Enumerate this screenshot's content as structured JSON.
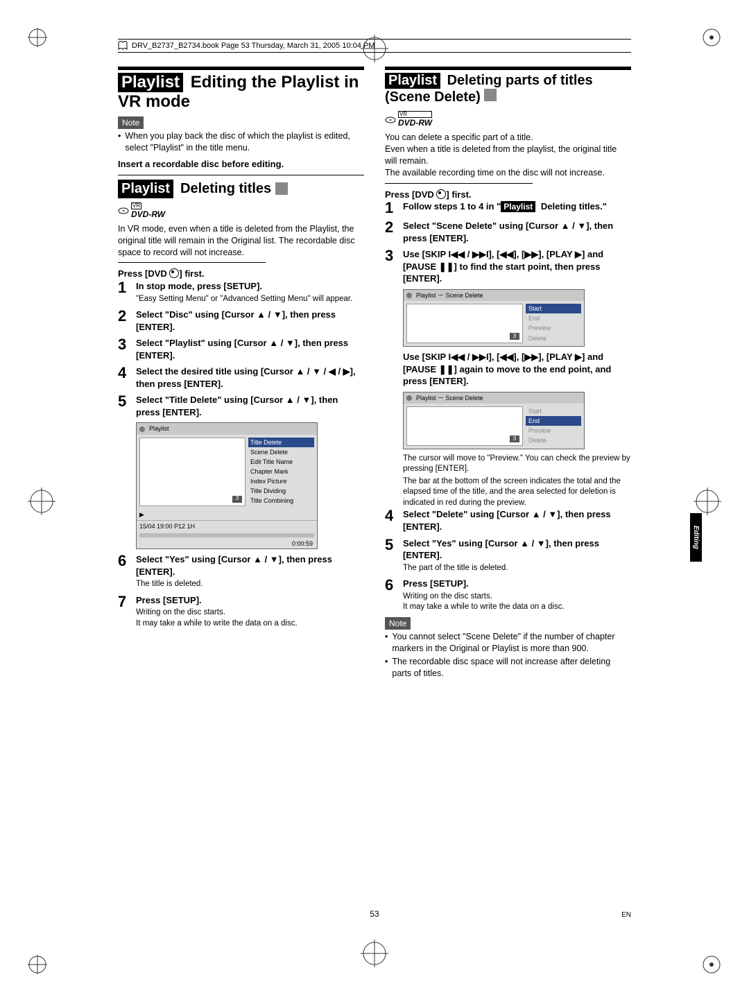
{
  "header": "DRV_B2737_B2734.book  Page 53  Thursday, March 31, 2005  10:04 PM",
  "left": {
    "title_pre": "Playlist",
    "title": " Editing the Playlist in VR mode",
    "note_label": "Note",
    "note_bullet": "When you play back the disc of which the playlist is edited, select \"Playlist\" in the title menu.",
    "insert": "Insert a recordable disc before editing.",
    "sub_pre": "Playlist",
    "sub": " Deleting titles ",
    "dvd_label": "DVD-RW",
    "vr_label": "VR",
    "intro": "In VR mode, even when a title is deleted from the Playlist, the original title will remain in the Original list. The recordable disc space to record will not increase.",
    "press_dvd": "Press [DVD ",
    "press_dvd2": "] first.",
    "steps": [
      {
        "n": "1",
        "b": "In stop mode, press [SETUP].",
        "note": "\"Easy Setting Menu\" or \"Advanced Setting Menu\" will appear."
      },
      {
        "n": "2",
        "b": "Select \"Disc\" using [Cursor ▲ / ▼], then press [ENTER]."
      },
      {
        "n": "3",
        "b": "Select \"Playlist\" using [Cursor ▲ / ▼], then press [ENTER]."
      },
      {
        "n": "4",
        "b": "Select the desired title using [Cursor ▲ / ▼ / ◀ / ▶], then press [ENTER]."
      },
      {
        "n": "5",
        "b": "Select \"Title Delete\" using [Cursor ▲ / ▼], then press [ENTER]."
      },
      {
        "n": "6",
        "b": "Select \"Yes\" using [Cursor ▲ / ▼], then press [ENTER].",
        "note": "The title is deleted."
      },
      {
        "n": "7",
        "b": "Press [SETUP].",
        "note": "Writing on the disc starts.\nIt may take a while to write the data on a disc."
      }
    ],
    "ui": {
      "title": "Playlist",
      "thumb": "3",
      "menu": [
        "Title Delete",
        "Scene Delete",
        "Edit Title Name",
        "Chapter Mark",
        "Index Picture",
        "Title Dividing",
        "Title Combining"
      ],
      "foot_left": "15/04  19:00  P12  1H",
      "time": "0:00:59"
    }
  },
  "right": {
    "title_pre": "Playlist",
    "title": " Deleting parts of titles (Scene Delete) ",
    "dvd_label": "DVD-RW",
    "vr_label": "VR",
    "p1": "You can delete a specific part of a title.",
    "p2": "Even when a title is deleted from the playlist, the original title will remain.",
    "p3": "The available recording time on the disc will not increase.",
    "press_dvd": "Press [DVD ",
    "press_dvd2": "] first.",
    "steps": [
      {
        "n": "1",
        "b": "Follow steps 1 to 4 in \"",
        "tag": "Playlist",
        "b2": " Deleting titles.\""
      },
      {
        "n": "2",
        "b": "Select \"Scene Delete\" using [Cursor ▲ / ▼], then press [ENTER]."
      },
      {
        "n": "3",
        "b": "Use [SKIP I◀◀ / ▶▶I], [◀◀], [▶▶], [PLAY ▶] and [PAUSE ❚❚] to find the start point, then press [ENTER]."
      }
    ],
    "ui1": {
      "title": "Playlist － Scene Delete",
      "thumb": "3",
      "list": [
        "Start",
        "End",
        "Preview",
        "Delete"
      ],
      "sel": 0
    },
    "mid": "Use [SKIP I◀◀ / ▶▶I], [◀◀], [▶▶], [PLAY ▶] and [PAUSE ❚❚] again to move to the end point, and press [ENTER].",
    "ui2": {
      "title": "Playlist － Scene Delete",
      "thumb": "3",
      "list": [
        "Start",
        "End",
        "Preview",
        "Delete"
      ],
      "sel": 1
    },
    "after_ui": "The cursor will move to \"Preview.\"  You can check the preview by pressing [ENTER].",
    "after_ui2": "The bar at the bottom of the screen indicates the total and the elapsed time of the title, and the area selected for deletion is indicated in red during the preview.",
    "steps2": [
      {
        "n": "4",
        "b": "Select \"Delete\" using [Cursor ▲ / ▼], then press [ENTER]."
      },
      {
        "n": "5",
        "b": "Select \"Yes\" using [Cursor ▲ / ▼], then press [ENTER].",
        "note": "The part of the title is deleted."
      },
      {
        "n": "6",
        "b": "Press [SETUP].",
        "note": "Writing on the disc starts.\nIt may take a while to write the data on a disc."
      }
    ],
    "note_label": "Note",
    "notes": [
      "You cannot select \"Scene Delete\" if the number of chapter markers in the Original or Playlist is more than 900.",
      "The recordable disc space will not increase after deleting parts of titles."
    ]
  },
  "side_tab": "Editing",
  "page_number": "53",
  "page_lang": "EN"
}
